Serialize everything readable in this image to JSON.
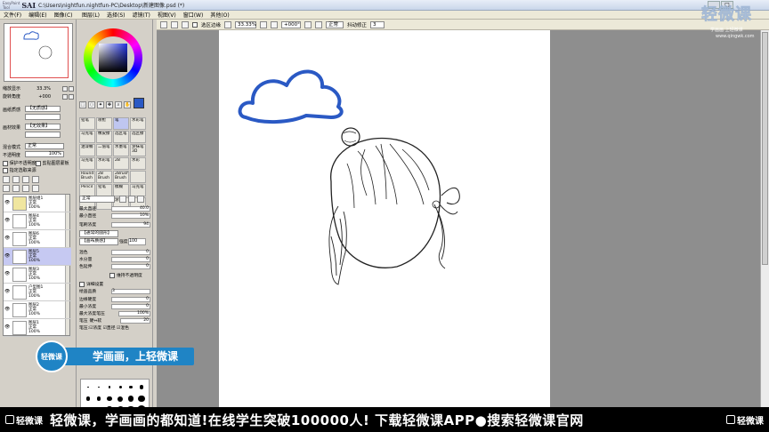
{
  "window": {
    "logo_small": "EasyPaint Tool",
    "logo": "SAI",
    "title_path": "C:\\Users\\nightfun.nightfun-PC\\Desktop\\新建图像.psd (*)",
    "btn_min": "_",
    "btn_max": "□"
  },
  "menu": {
    "left": [
      "文件(F)",
      "编辑(E)",
      "图像(C)"
    ],
    "right": [
      "图层(L)",
      "选择(S)",
      "滤镜(T)",
      "视图(V)",
      "窗口(W)",
      "其他(O)"
    ]
  },
  "toolbar": {
    "select_source": "选区边缘",
    "zoom": "33.33%",
    "rotation": "+000°",
    "mode": "正常",
    "stabilizer_label": "抖动修正",
    "stabilizer_value": "3"
  },
  "navigator": {
    "zoom_label": "缩放显示",
    "zoom_value": "33.3%",
    "angle_label": "旋转角度",
    "angle_value": "+000"
  },
  "layer_panel": {
    "texture_label": "画纸质感",
    "texture_value": "【无质感】",
    "effect_label": "画材效果",
    "effect_value": "【无效果】",
    "blend_label": "混合模式",
    "blend_value": "正常",
    "opacity_label": "不透明度",
    "opacity_value": "100%",
    "protect_label": "保护不透明度",
    "clip_label": "剪贴图层蒙板",
    "specify_label": "指定选取来源",
    "layers": [
      {
        "name": "图层组1",
        "mode": "正常",
        "opacity": "100%",
        "folder": true,
        "selected": false
      },
      {
        "name": "图层4",
        "mode": "正常",
        "opacity": "100%",
        "folder": false,
        "selected": false
      },
      {
        "name": "图层6",
        "mode": "正常",
        "opacity": "100%",
        "folder": false,
        "selected": false
      },
      {
        "name": "图层5",
        "mode": "正常",
        "opacity": "100%",
        "folder": false,
        "selected": true
      },
      {
        "name": "图层3",
        "mode": "正常",
        "opacity": "100%",
        "folder": false,
        "selected": false
      },
      {
        "name": "户型图1",
        "mode": "正常",
        "opacity": "100%",
        "folder": false,
        "selected": false
      },
      {
        "name": "图层2",
        "mode": "正常",
        "opacity": "100%",
        "folder": false,
        "selected": false
      },
      {
        "name": "图层1",
        "mode": "正常",
        "opacity": "100%",
        "folder": false,
        "selected": false
      }
    ]
  },
  "colors": {
    "current": "#2a59c4",
    "selected_layer": "#c6c9f2",
    "ribbon": "#1f84c5",
    "cloud_stroke": "#2a59c4"
  },
  "tools": {
    "brushes": [
      {
        "l1": "铅笔",
        "l2": "",
        "sel": false
      },
      {
        "l1": "喷枪",
        "l2": "",
        "sel": false
      },
      {
        "l1": "笔",
        "l2": "",
        "sel": true
      },
      {
        "l1": "水彩笔",
        "l2": "",
        "sel": false
      },
      {
        "l1": "马克笔",
        "l2": "",
        "sel": false
      },
      {
        "l1": "橡皮擦",
        "l2": "",
        "sel": false
      },
      {
        "l1": "选区笔",
        "l2": "",
        "sel": false
      },
      {
        "l1": "选区擦",
        "l2": "",
        "sel": false
      },
      {
        "l1": "油漆桶",
        "l2": "",
        "sel": false
      },
      {
        "l1": "二值笔",
        "l2": "",
        "sel": false
      },
      {
        "l1": "水墨笔",
        "l2": "",
        "sel": false
      },
      {
        "l1": "涂抹笔3D",
        "l2": "",
        "sel": false
      },
      {
        "l1": "马克笔",
        "l2": "",
        "sel": false
      },
      {
        "l1": "水彩笔",
        "l2": "",
        "sel": false
      },
      {
        "l1": "2B",
        "l2": "",
        "sel": false
      },
      {
        "l1": "水彩",
        "l2": "",
        "sel": false
      },
      {
        "l1": "Round",
        "l2": "Brush",
        "sel": false
      },
      {
        "l1": "2B",
        "l2": "Brush",
        "sel": false
      },
      {
        "l1": "2Brush",
        "l2": "Brush",
        "sel": false
      },
      {
        "l1": "",
        "l2": "",
        "sel": false
      },
      {
        "l1": "Pencil",
        "l2": "",
        "sel": false
      },
      {
        "l1": "铅笔",
        "l2": "",
        "sel": false
      },
      {
        "l1": "模糊",
        "l2": "",
        "sel": false
      },
      {
        "l1": "马克笔",
        "l2": "",
        "sel": false
      },
      {
        "l1": "",
        "l2": "",
        "sel": false
      },
      {
        "l1": "",
        "l2": "",
        "sel": false
      },
      {
        "l1": "涂笔",
        "l2": "",
        "sel": false
      },
      {
        "l1": "",
        "l2": "",
        "sel": false
      }
    ],
    "blend_mode": "正常",
    "max_size_label": "最大直径",
    "max_size_value": "40.0",
    "min_size_label": "最小直径",
    "min_size_value": "10%",
    "density_label": "笔刷浓度",
    "density_value": "94",
    "shape_value": "【通常的圆形】",
    "texture_value": "【画布质感】",
    "texture_strength_label": "强度",
    "texture_strength_value": "100",
    "mix_label": "混色",
    "mix_value": "0",
    "water_label": "水分量",
    "water_value": "0",
    "color_extend_label": "色延伸",
    "color_extend_value": "0",
    "keep_opacity_label": "维持不透明度",
    "detail_label": "详细设置",
    "quality_label": "绘画品质",
    "quality_value": "3",
    "edge_label": "边缘硬度",
    "edge_value": "0",
    "min_density_label": "最小浓度",
    "min_density_value": "0",
    "max_pressure_label": "最大浓度笔压",
    "max_pressure_value": "100%",
    "pressure_label": "笔压",
    "pressure_hard": "硬⇔软",
    "pressure_value": "20",
    "pressure_flags": "笔压:☑浓度 ☑直径 ☑混色"
  },
  "watermark": {
    "big": "轻微课",
    "sub": "学画画 上轻微课",
    "url": "www.qingwk.com"
  },
  "ribbon": {
    "circle_text": "轻微课",
    "text": "学画画，上轻微课"
  },
  "banner": {
    "brand": "轻微课",
    "message": "轻微课，学画画的都知道!在线学生突破100000人! 下载轻微课APP●搜索轻微课官网",
    "brand_right": "轻微课"
  }
}
